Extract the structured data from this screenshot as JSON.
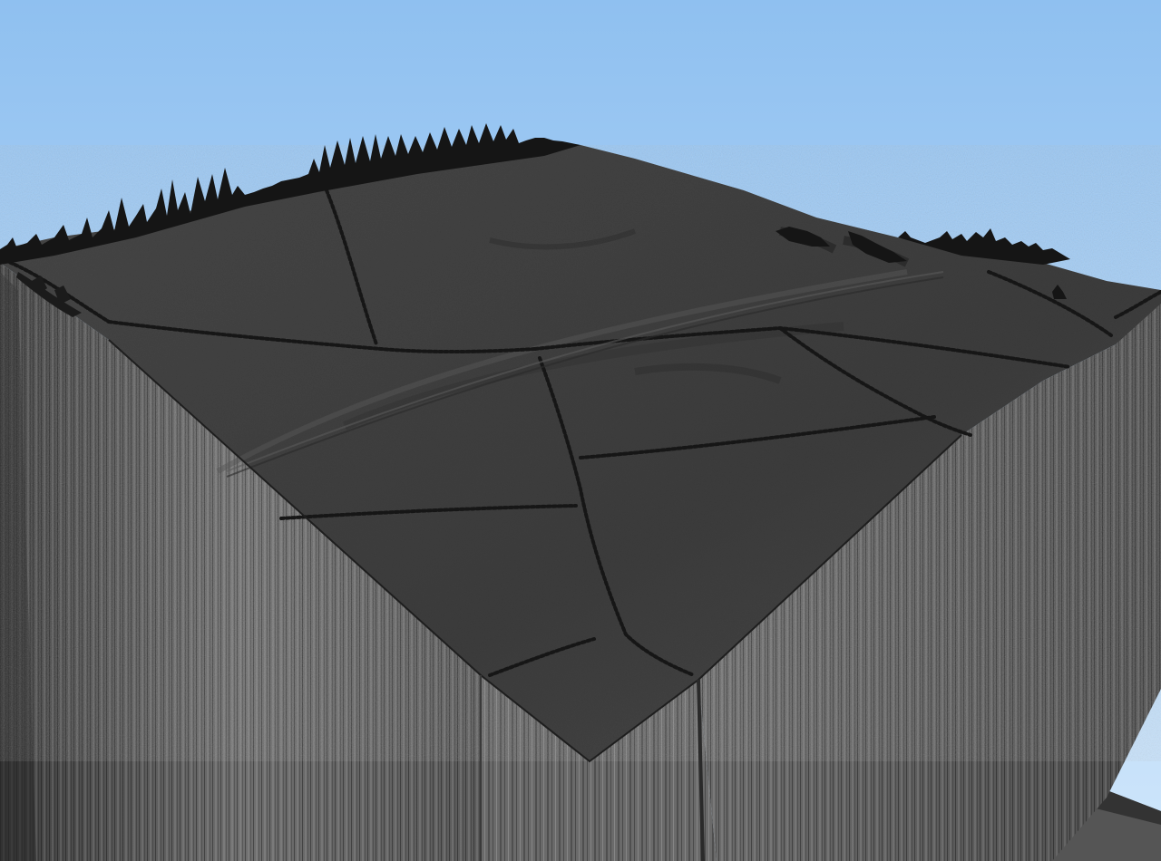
{
  "scene": {
    "subject": "terrain-block-render",
    "colors": {
      "sky_top": "#8fc0f0",
      "sky_bottom": "#cfe6fb",
      "terrain_top": "#3f3f3f",
      "terrain_shadow": "#2a2a2a",
      "wall_left": "#5c5c5c",
      "wall_front": "#6a6a6a",
      "wall_right": "#575757",
      "hedge": "#141414"
    }
  }
}
